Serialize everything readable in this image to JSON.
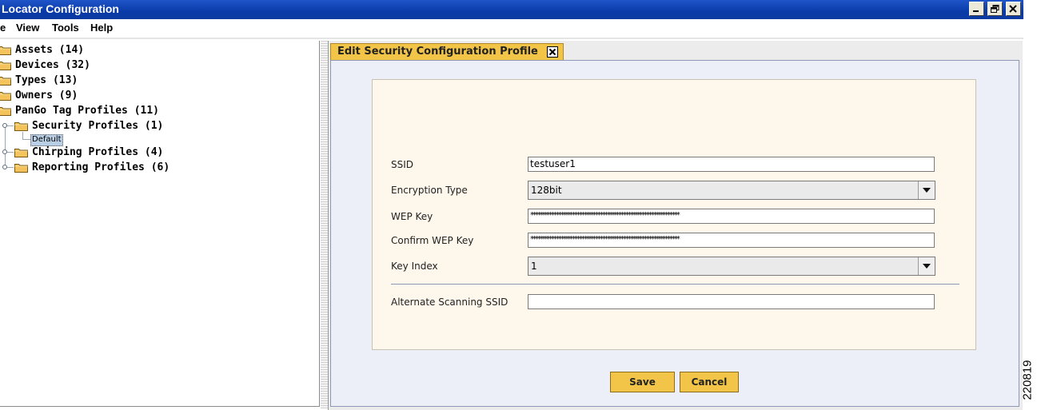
{
  "window": {
    "title": "Locator Configuration"
  },
  "menu": {
    "items": [
      "e",
      "View",
      "Tools",
      "Help"
    ]
  },
  "tree": {
    "nodes": [
      "Assets (14)",
      "Devices (32)",
      "Types (13)",
      "Owners (9)",
      "PanGo Tag Profiles (11)",
      "Security Profiles (1)",
      "Chirping Profiles (4)",
      "Reporting Profiles (6)"
    ],
    "selected_leaf": "Default"
  },
  "tab": {
    "label": "Edit Security Configuration Profile"
  },
  "form": {
    "ssid_label": "SSID",
    "ssid_value": "testuser1",
    "encryption_label": "Encryption Type",
    "encryption_value": "128bit",
    "wep_key_label": "WEP Key",
    "wep_key_value": "****************************************************************",
    "confirm_wep_key_label": "Confirm WEP Key",
    "confirm_wep_key_value": "****************************************************************",
    "key_index_label": "Key Index",
    "key_index_value": "1",
    "alternate_ssid_label": "Alternate Scanning SSID",
    "alternate_ssid_value": ""
  },
  "buttons": {
    "save": "Save",
    "cancel": "Cancel"
  },
  "figure_id": "220819",
  "colors": {
    "title_bar": "#0a3aa8",
    "tab_accent": "#f2c548",
    "panel_bg": "#fdf7ec"
  },
  "icons": {
    "window_controls": [
      "minimize-icon",
      "restore-icon",
      "close-icon"
    ],
    "tree_folder": "folder-icon"
  }
}
